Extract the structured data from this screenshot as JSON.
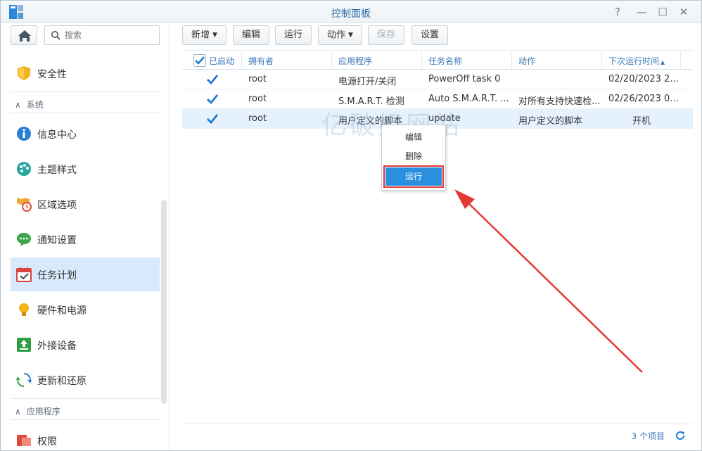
{
  "window": {
    "title": "控制面板",
    "controls": [
      "?",
      "—",
      "☐",
      "✕"
    ]
  },
  "sidebar": {
    "search_placeholder": "搜索",
    "items": [
      {
        "label": "安全性",
        "icon": "shield-icon"
      },
      {
        "label": "信息中心",
        "icon": "info-icon"
      },
      {
        "label": "主题样式",
        "icon": "palette-icon"
      },
      {
        "label": "区域选项",
        "icon": "map-clock-icon"
      },
      {
        "label": "通知设置",
        "icon": "chat-icon"
      },
      {
        "label": "任务计划",
        "icon": "calendar-check-icon",
        "active": true
      },
      {
        "label": "硬件和电源",
        "icon": "bulb-icon"
      },
      {
        "label": "外接设备",
        "icon": "external-device-icon"
      },
      {
        "label": "更新和还原",
        "icon": "refresh-icon"
      },
      {
        "label": "权限",
        "icon": "permission-icon"
      }
    ],
    "sections": {
      "system": "系统",
      "apps": "应用程序"
    }
  },
  "toolbar": {
    "create": "新增",
    "edit": "编辑",
    "run": "运行",
    "action": "动作",
    "save": "保存",
    "settings": "设置"
  },
  "grid": {
    "columns": [
      "已启动",
      "拥有者",
      "应用程序",
      "任务名称",
      "动作",
      "下次运行时间"
    ],
    "rows": [
      {
        "enabled": true,
        "owner": "root",
        "app": "电源打开/关闭",
        "task": "PowerOff task 0",
        "action": "",
        "next": "02/20/2023 2..."
      },
      {
        "enabled": true,
        "owner": "root",
        "app": "S.M.A.R.T. 检测",
        "task": "Auto S.M.A.R.T. ...",
        "action": "对所有支持快速检...",
        "next": "02/26/2023 0..."
      },
      {
        "enabled": true,
        "owner": "root",
        "app": "用户定义的脚本",
        "task": "update",
        "action": "用户定义的脚本",
        "next": "开机"
      }
    ],
    "footer_count": "3 个项目"
  },
  "context_menu": {
    "items": [
      "编辑",
      "删除",
      "运行"
    ]
  },
  "watermark": "亿破姐网站",
  "colors": {
    "accent": "#2b8fe0",
    "highlight": "#e53935",
    "selected_row": "#e5f1fd"
  }
}
